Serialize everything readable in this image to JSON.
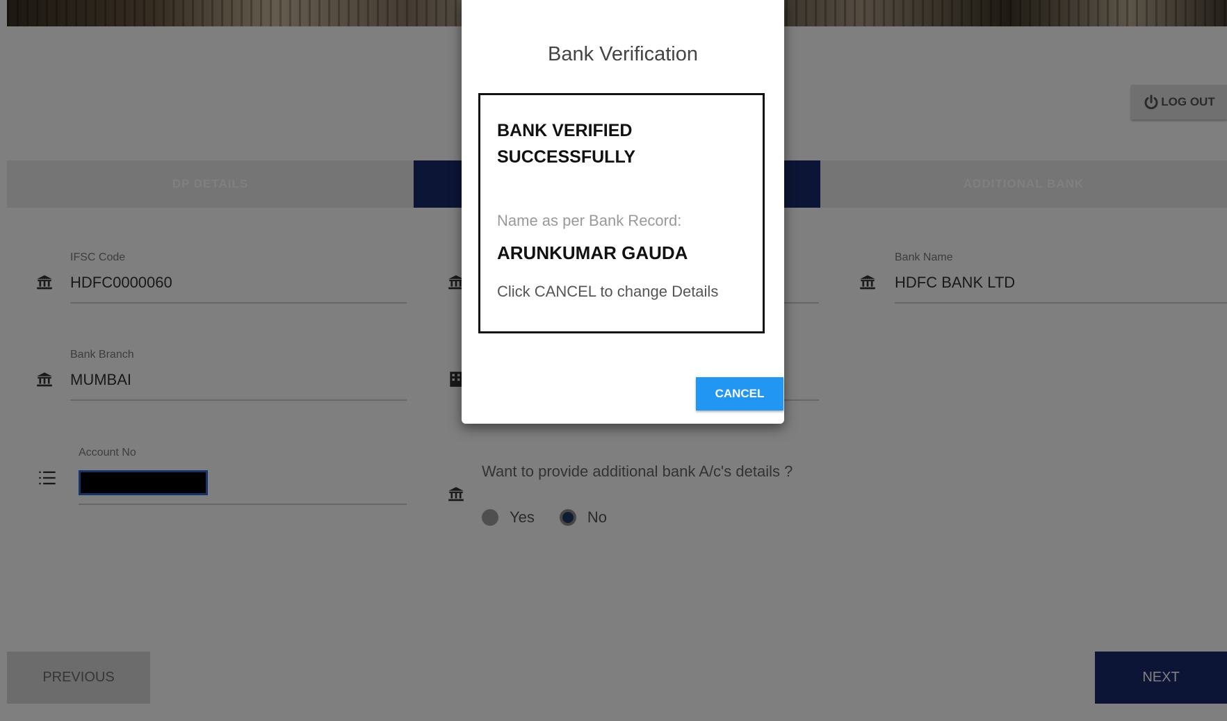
{
  "header": {
    "logout_label": "LOG OUT",
    "logout_icon": "power-icon"
  },
  "tabs": [
    {
      "label": "DP DETAILS"
    },
    {
      "label": ""
    },
    {
      "label": "ADDITIONAL BANK"
    }
  ],
  "form": {
    "ifsc": {
      "label": "IFSC Code",
      "value": "HDFC0000060",
      "icon": "bank-icon"
    },
    "bank_name": {
      "label": "Bank Name",
      "value": "HDFC BANK LTD",
      "icon": "bank-icon"
    },
    "bank_branch": {
      "label": "Bank Branch",
      "value": "MUMBAI",
      "icon": "bank-icon"
    },
    "account_no": {
      "label": "Account No",
      "icon": "list-icon"
    },
    "additional_question": "Want to provide additional bank A/c's details ?",
    "radio_yes": "Yes",
    "radio_no": "No",
    "selected": "No"
  },
  "nav": {
    "previous_label": "PREVIOUS",
    "next_label": "NEXT"
  },
  "modal": {
    "title": "Bank Verification",
    "status_line1": "BANK VERIFIED",
    "status_line2": "SUCCESSFULLY",
    "name_label": "Name as per Bank Record:",
    "name_value": "ARUNKUMAR GAUDA",
    "hint": "Click CANCEL to change Details",
    "cancel_label": "CANCEL"
  },
  "colors": {
    "primary": "#1a2a6c",
    "cancel_button": "#2196f3",
    "overlay": "rgba(0,0,0,0.5)"
  }
}
